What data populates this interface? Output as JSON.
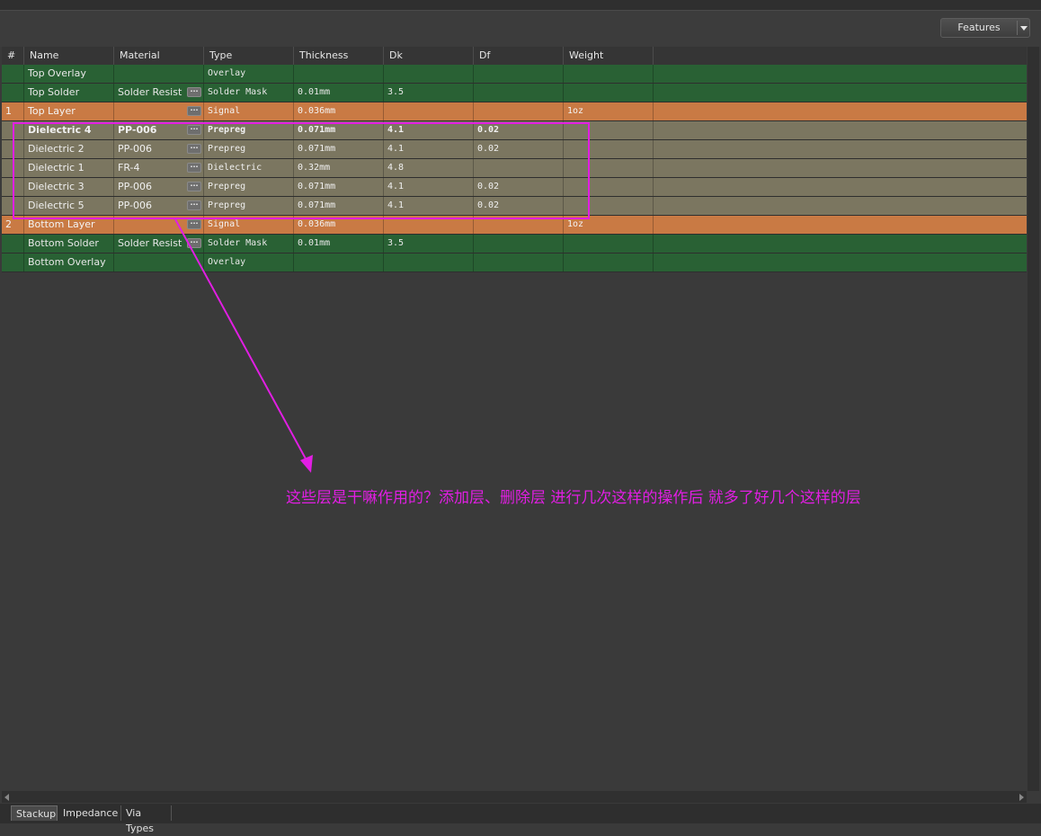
{
  "toolbar": {
    "features_label": "Features"
  },
  "columns": [
    "#",
    "Name",
    "Material",
    "Type",
    "Thickness",
    "Dk",
    "Df",
    "Weight"
  ],
  "rows": [
    {
      "num": "",
      "name": "Top Overlay",
      "material": "",
      "has_ellipsis": false,
      "type": "Overlay",
      "thickness": "",
      "dk": "",
      "df": "",
      "weight": "",
      "kind": "green",
      "bold": false
    },
    {
      "num": "",
      "name": "Top Solder",
      "material": "Solder Resist",
      "has_ellipsis": true,
      "type": "Solder Mask",
      "thickness": "0.01mm",
      "dk": "3.5",
      "df": "",
      "weight": "",
      "kind": "green",
      "bold": false
    },
    {
      "num": "1",
      "name": "Top Layer",
      "material": "",
      "has_ellipsis": true,
      "type": "Signal",
      "thickness": "0.036mm",
      "dk": "",
      "df": "",
      "weight": "1oz",
      "kind": "orange",
      "bold": false
    },
    {
      "num": "",
      "name": "Dielectric 4",
      "material": "PP-006",
      "has_ellipsis": true,
      "type": "Prepreg",
      "thickness": "0.071mm",
      "dk": "4.1",
      "df": "0.02",
      "weight": "",
      "kind": "gray",
      "bold": true
    },
    {
      "num": "",
      "name": "Dielectric 2",
      "material": "PP-006",
      "has_ellipsis": true,
      "type": "Prepreg",
      "thickness": "0.071mm",
      "dk": "4.1",
      "df": "0.02",
      "weight": "",
      "kind": "gray",
      "bold": false
    },
    {
      "num": "",
      "name": "Dielectric 1",
      "material": "FR-4",
      "has_ellipsis": true,
      "type": "Dielectric",
      "thickness": "0.32mm",
      "dk": "4.8",
      "df": "",
      "weight": "",
      "kind": "gray",
      "bold": false
    },
    {
      "num": "",
      "name": "Dielectric 3",
      "material": "PP-006",
      "has_ellipsis": true,
      "type": "Prepreg",
      "thickness": "0.071mm",
      "dk": "4.1",
      "df": "0.02",
      "weight": "",
      "kind": "gray",
      "bold": false
    },
    {
      "num": "",
      "name": "Dielectric 5",
      "material": "PP-006",
      "has_ellipsis": true,
      "type": "Prepreg",
      "thickness": "0.071mm",
      "dk": "4.1",
      "df": "0.02",
      "weight": "",
      "kind": "gray",
      "bold": false
    },
    {
      "num": "2",
      "name": "Bottom Layer",
      "material": "",
      "has_ellipsis": true,
      "type": "Signal",
      "thickness": "0.036mm",
      "dk": "",
      "df": "",
      "weight": "1oz",
      "kind": "orange",
      "bold": false
    },
    {
      "num": "",
      "name": "Bottom Solder",
      "material": "Solder Resist",
      "has_ellipsis": true,
      "type": "Solder Mask",
      "thickness": "0.01mm",
      "dk": "3.5",
      "df": "",
      "weight": "",
      "kind": "green",
      "bold": false
    },
    {
      "num": "",
      "name": "Bottom Overlay",
      "material": "",
      "has_ellipsis": false,
      "type": "Overlay",
      "thickness": "",
      "dk": "",
      "df": "",
      "weight": "",
      "kind": "green",
      "bold": false
    }
  ],
  "tabs": [
    "Stackup",
    "Impedance",
    "Via Types"
  ],
  "active_tab": "Stackup",
  "annotation": {
    "text": "这些层是干嘛作用的？添加层、删除层  进行几次这样的操作后    就多了好几个这样的层",
    "color": "#e11ee3"
  },
  "colors": {
    "signal_row": "#c97a44",
    "mask_row": "#296134",
    "dielectric_row": "#7b7660"
  }
}
